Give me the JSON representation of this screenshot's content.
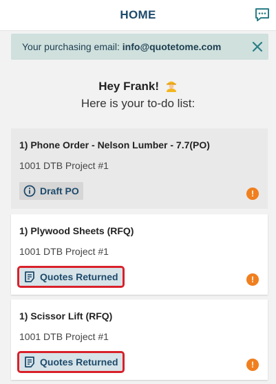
{
  "header": {
    "title": "HOME",
    "chat_icon": "chat-bubble-icon"
  },
  "banner": {
    "prefix": "Your purchasing email:",
    "email": "info@quotetome.com",
    "close_icon": "close-icon"
  },
  "greeting": {
    "text": "Hey Frank!",
    "emoji_icon": "worker-icon",
    "subtitle": "Here is your to-do list:"
  },
  "colors": {
    "brand": "#1d4a6b",
    "banner_bg": "#cfe0dd",
    "alert": "#f07f1f",
    "highlight": "#d9202a"
  },
  "todos": [
    {
      "title": "1) Phone Order - Nelson Lumber - 7.7(PO)",
      "project": "1001 DTB Project #1",
      "status": "Draft PO",
      "status_icon": "info-circle-icon",
      "alert_icon": "alert-icon",
      "alert_text": "!"
    },
    {
      "title": "1) Plywood Sheets (RFQ)",
      "project": "1001 DTB Project #1",
      "status": "Quotes Returned",
      "status_icon": "document-icon",
      "alert_icon": "alert-icon",
      "alert_text": "!"
    },
    {
      "title": "1) Scissor Lift (RFQ)",
      "project": "1001 DTB Project #1",
      "status": "Quotes Returned",
      "status_icon": "document-icon",
      "alert_icon": "alert-icon",
      "alert_text": "!"
    }
  ]
}
